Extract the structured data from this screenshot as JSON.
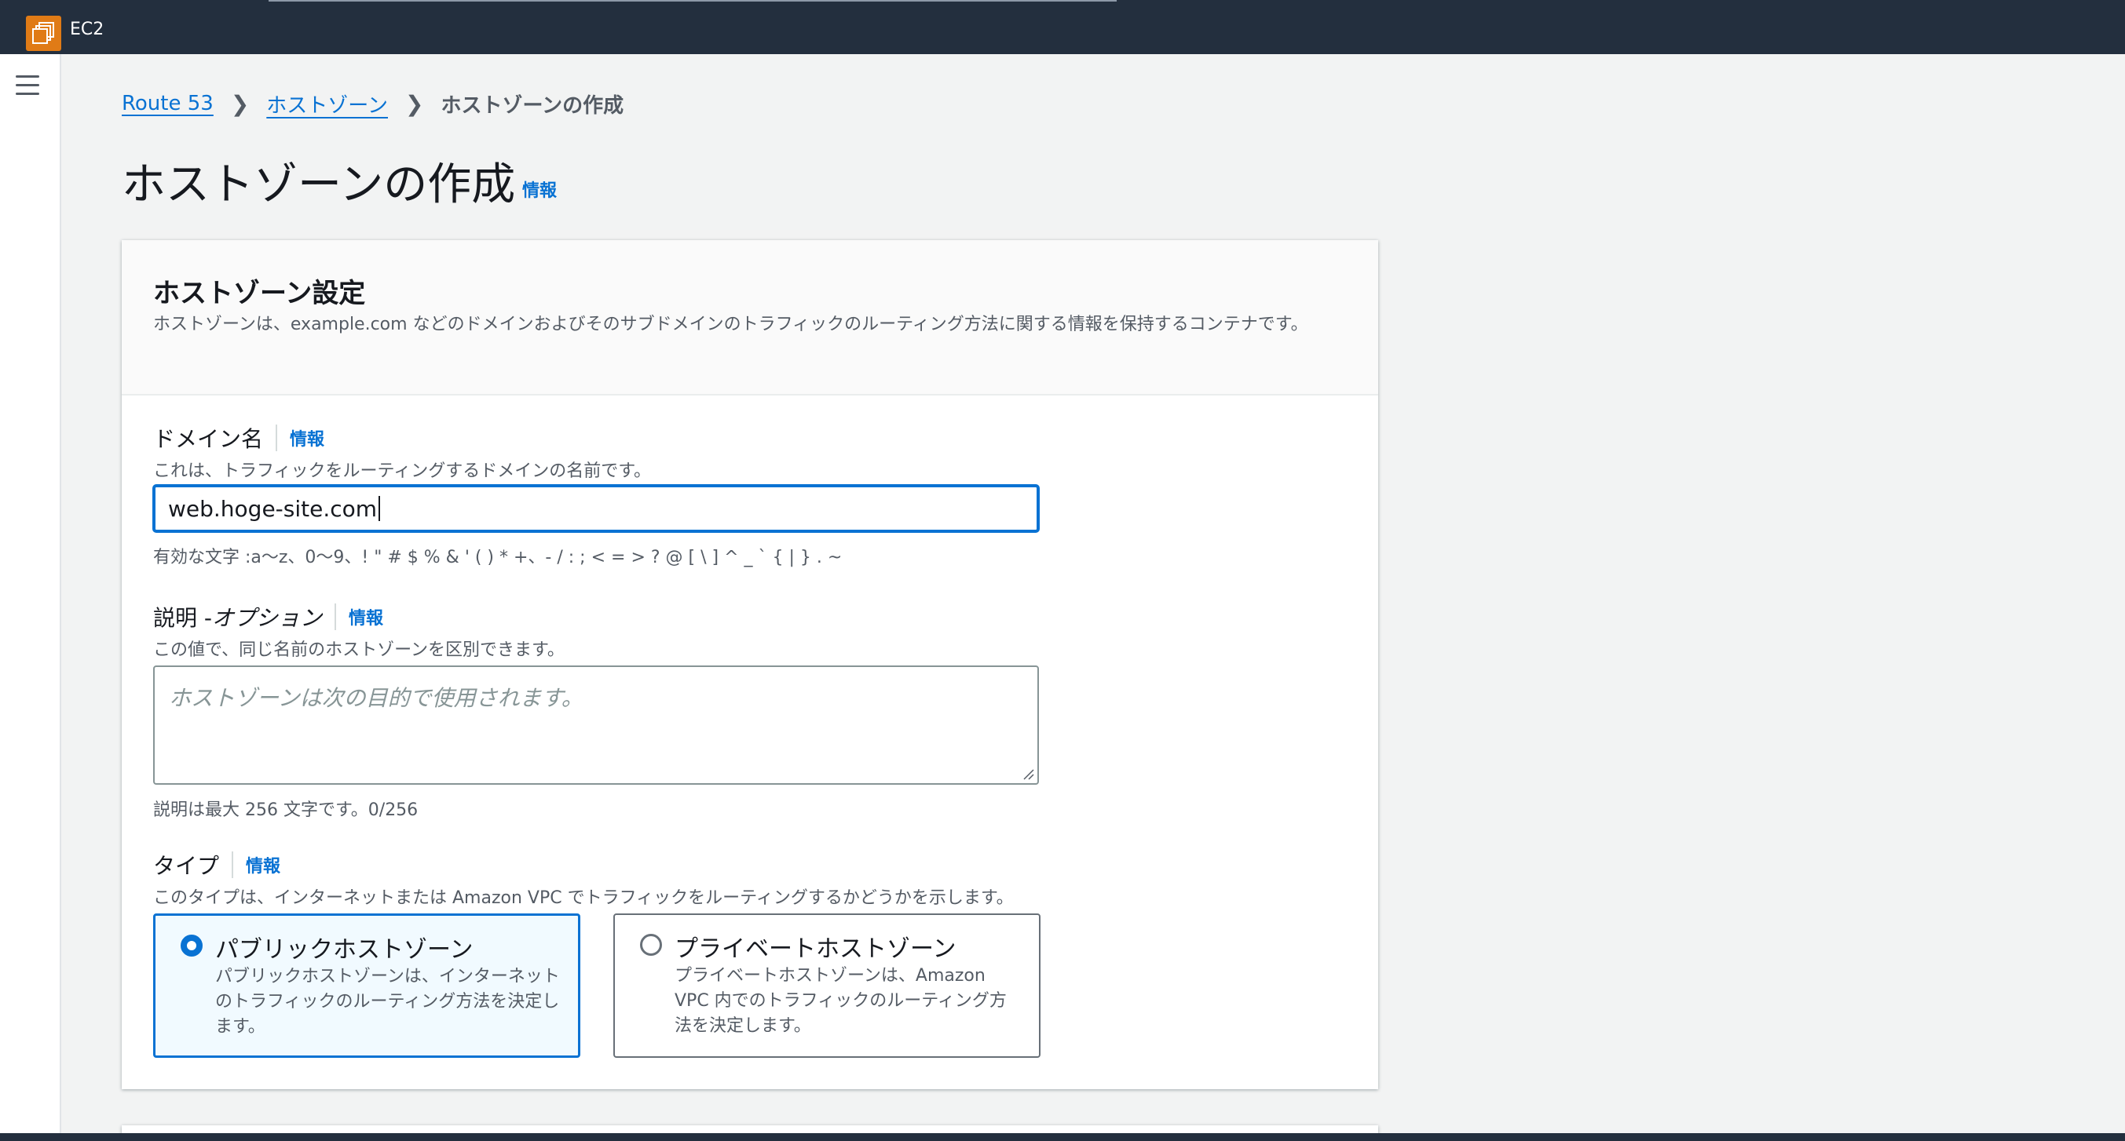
{
  "app": {
    "service_name": "EC2"
  },
  "breadcrumb": {
    "items": [
      "Route 53",
      "ホストゾーン"
    ],
    "current": "ホストゾーンの作成"
  },
  "page": {
    "title": "ホストゾーンの作成",
    "info": "情報"
  },
  "card": {
    "title": "ホストゾーン設定",
    "description": "ホストゾーンは、example.com などのドメインおよびそのサブドメインのトラフィックのルーティング方法に関する情報を保持するコンテナです。"
  },
  "domain": {
    "label": "ドメイン名",
    "info": "情報",
    "hint": "これは、トラフィックをルーティングするドメインの名前です。",
    "value": "web.hoge-site.com",
    "constraint": "有効な文字 :a〜z、0〜9、! \" # $ % & ' ( ) * +、- / : ; < = > ? @ [ \\ ] ^ _ ` { | } . ~"
  },
  "description_field": {
    "label": "説明 - ",
    "label_optional": "オプション",
    "info": "情報",
    "hint": "この値で、同じ名前のホストゾーンを区別できます。",
    "placeholder": "ホストゾーンは次の目的で使用されます。",
    "counter": "説明は最大 256 文字です。0/256"
  },
  "type": {
    "label": "タイプ",
    "info": "情報",
    "hint": "このタイプは、インターネットまたは Amazon VPC でトラフィックをルーティングするかどうかを示します。",
    "options": [
      {
        "title": "パブリックホストゾーン",
        "description": "パブリックホストゾーンは、インターネットのトラフィックのルーティング方法を決定します。",
        "selected": true
      },
      {
        "title": "プライベートホストゾーン",
        "description": "プライベートホストゾーンは、Amazon VPC 内でのトラフィックのルーティング方法を決定します。",
        "selected": false
      }
    ]
  },
  "colors": {
    "nav_bg": "#232f3e",
    "link": "#0972d3",
    "service_icon": "#e07b16",
    "selected_tile_bg": "#f1faff"
  },
  "icons": [
    "ec2-service-icon",
    "hamburger-menu-icon",
    "chevron-right-icon",
    "radio-selected-icon",
    "radio-unselected-icon",
    "resize-handle-icon"
  ]
}
